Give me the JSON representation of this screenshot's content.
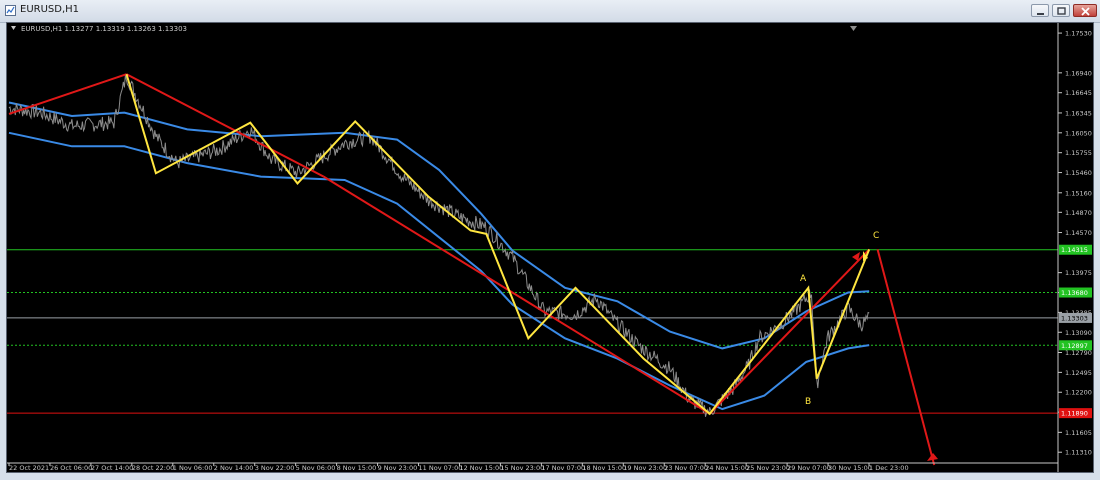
{
  "window": {
    "title": "EURUSD,H1",
    "buttons": {
      "minimize": "minimize-icon",
      "maximize": "maximize-icon",
      "close": "close-icon"
    }
  },
  "chart_info": "EURUSD,H1   1.13277  1.13319  1.13263  1.13303",
  "chart_data": {
    "type": "line",
    "symbol": "EURUSD",
    "timeframe": "H1",
    "ohlc": {
      "open": 1.13277,
      "high": 1.13319,
      "low": 1.13263,
      "close": 1.13303
    },
    "ylim": [
      1.1115,
      1.1765
    ],
    "y_ticks": [
      1.1753,
      1.1694,
      1.16645,
      1.16345,
      1.1605,
      1.15755,
      1.1546,
      1.1516,
      1.1487,
      1.1457,
      1.13975,
      1.1368,
      1.13385,
      1.1309,
      1.1279,
      1.12495,
      1.122,
      1.11905,
      1.11605,
      1.1131
    ],
    "x_ticks": [
      "22 Oct 2021",
      "26 Oct 06:00",
      "27 Oct 14:00",
      "28 Oct 22:00",
      "1 Nov 06:00",
      "2 Nov 14:00",
      "3 Nov 22:00",
      "5 Nov 06:00",
      "8 Nov 15:00",
      "9 Nov 23:00",
      "11 Nov 07:00",
      "12 Nov 15:00",
      "15 Nov 23:00",
      "17 Nov 07:00",
      "18 Nov 15:00",
      "19 Nov 23:00",
      "23 Nov 07:00",
      "24 Nov 15:00",
      "25 Nov 23:00",
      "29 Nov 07:00",
      "30 Nov 15:00",
      "1 Dec 23:00"
    ],
    "price_labels": [
      {
        "value": "1.14315",
        "color": "#22c322"
      },
      {
        "value": "1.13680",
        "color": "#22c322"
      },
      {
        "value": "1.13303",
        "color": "#9aa0a6"
      },
      {
        "value": "1.12897",
        "color": "#22c322"
      },
      {
        "value": "1.11890",
        "color": "#e01010"
      }
    ],
    "annotations": [
      "A",
      "B",
      "C"
    ],
    "colors": {
      "price": "#8c8c8c",
      "channel": "#3a8ae6",
      "zigzag": "#ffe640",
      "trend": "#e01818",
      "level_green": "#22c322",
      "level_red": "#e01010",
      "annotation": "#ffe640"
    }
  }
}
